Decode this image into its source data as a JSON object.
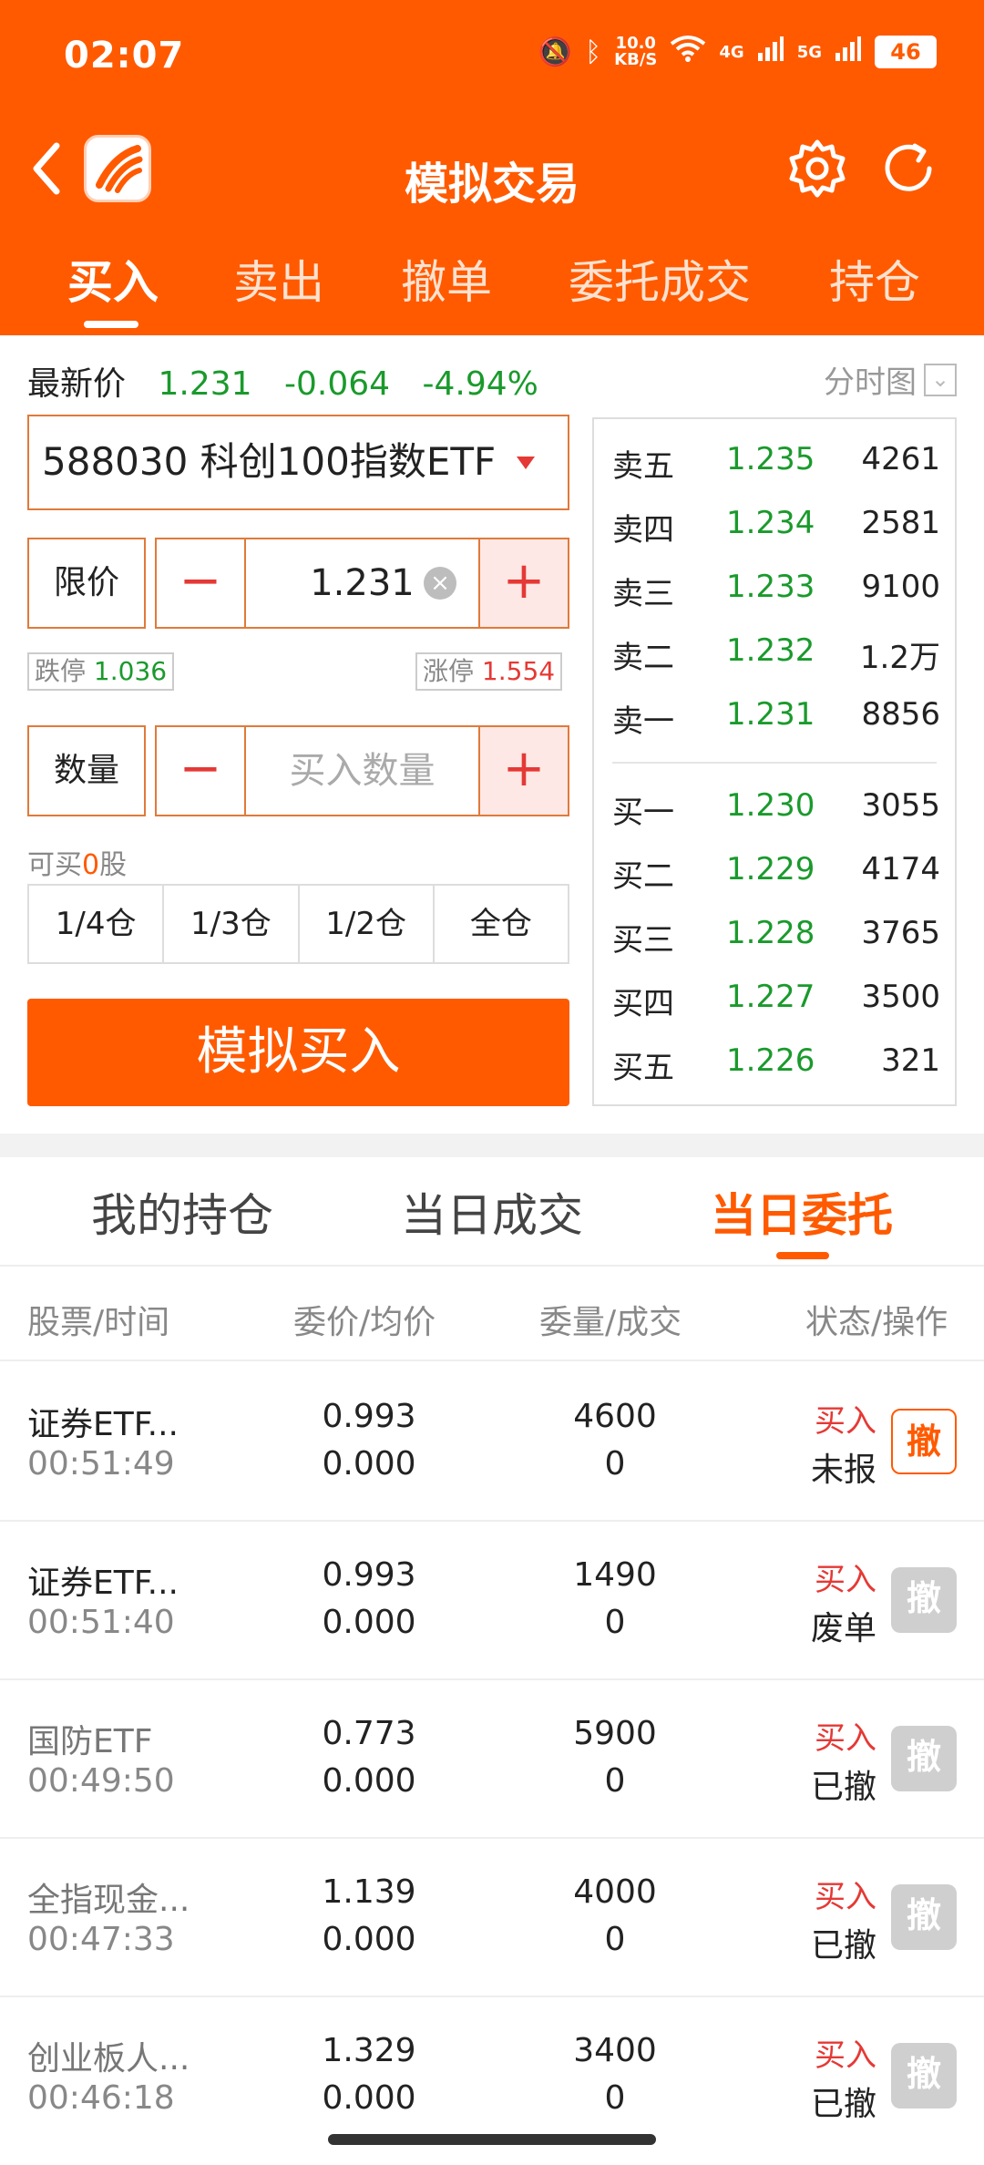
{
  "status_bar": {
    "time": "02:07",
    "net_speed": "10.0",
    "net_unit": "KB/S",
    "sig1": "4G",
    "sig2": "5G",
    "battery": "46"
  },
  "title": "模拟交易",
  "tabs": [
    "买入",
    "卖出",
    "撤单",
    "委托成交",
    "持仓"
  ],
  "quote": {
    "label": "最新价",
    "price": "1.231",
    "change": "-0.064",
    "pct": "-4.94%",
    "chart_link": "分时图"
  },
  "stock": {
    "code_name": "588030  科创100指数ETF"
  },
  "price_input": {
    "label": "限价",
    "value": "1.231",
    "minus": "−",
    "plus": "+"
  },
  "limits": {
    "down_label": "跌停",
    "down_value": "1.036",
    "up_label": "涨停",
    "up_value": "1.554"
  },
  "qty_input": {
    "label": "数量",
    "placeholder": "买入数量",
    "minus": "−",
    "plus": "+"
  },
  "can_buy": {
    "prefix": "可买",
    "count": "0",
    "suffix": "股"
  },
  "portions": [
    "1/4仓",
    "1/3仓",
    "1/2仓",
    "全仓"
  ],
  "buy_button": "模拟买入",
  "orderbook": {
    "asks": [
      {
        "label": "卖五",
        "price": "1.235",
        "vol": "4261"
      },
      {
        "label": "卖四",
        "price": "1.234",
        "vol": "2581"
      },
      {
        "label": "卖三",
        "price": "1.233",
        "vol": "9100"
      },
      {
        "label": "卖二",
        "price": "1.232",
        "vol": "1.2万"
      },
      {
        "label": "卖一",
        "price": "1.231",
        "vol": "8856"
      }
    ],
    "bids": [
      {
        "label": "买一",
        "price": "1.230",
        "vol": "3055"
      },
      {
        "label": "买二",
        "price": "1.229",
        "vol": "4174"
      },
      {
        "label": "买三",
        "price": "1.228",
        "vol": "3765"
      },
      {
        "label": "买四",
        "price": "1.227",
        "vol": "3500"
      },
      {
        "label": "买五",
        "price": "1.226",
        "vol": "321"
      }
    ]
  },
  "sub_tabs": [
    "我的持仓",
    "当日成交",
    "当日委托"
  ],
  "table_headers": [
    "股票/时间",
    "委价/均价",
    "委量/成交",
    "状态/操作"
  ],
  "orders": [
    {
      "name": "证券ETF...",
      "time": "00:51:49",
      "price": "0.993",
      "avg": "0.000",
      "qty": "4600",
      "filled": "0",
      "type": "买入",
      "status": "未报",
      "cancel": "撤"
    },
    {
      "name": "证券ETF...",
      "time": "00:51:40",
      "price": "0.993",
      "avg": "0.000",
      "qty": "1490",
      "filled": "0",
      "type": "买入",
      "status": "废单",
      "cancel": "撤"
    },
    {
      "name": "国防ETF",
      "time": "00:49:50",
      "price": "0.773",
      "avg": "0.000",
      "qty": "5900",
      "filled": "0",
      "type": "买入",
      "status": "已撤",
      "cancel": "撤"
    },
    {
      "name": "全指现金...",
      "time": "00:47:33",
      "price": "1.139",
      "avg": "0.000",
      "qty": "4000",
      "filled": "0",
      "type": "买入",
      "status": "已撤",
      "cancel": "撤"
    },
    {
      "name": "创业板人...",
      "time": "00:46:18",
      "price": "1.329",
      "avg": "0.000",
      "qty": "3400",
      "filled": "0",
      "type": "买入",
      "status": "已撤",
      "cancel": "撤"
    }
  ],
  "colors": {
    "brand": "#ff5a00",
    "up": "#e53935",
    "down": "#1a9a2c"
  }
}
